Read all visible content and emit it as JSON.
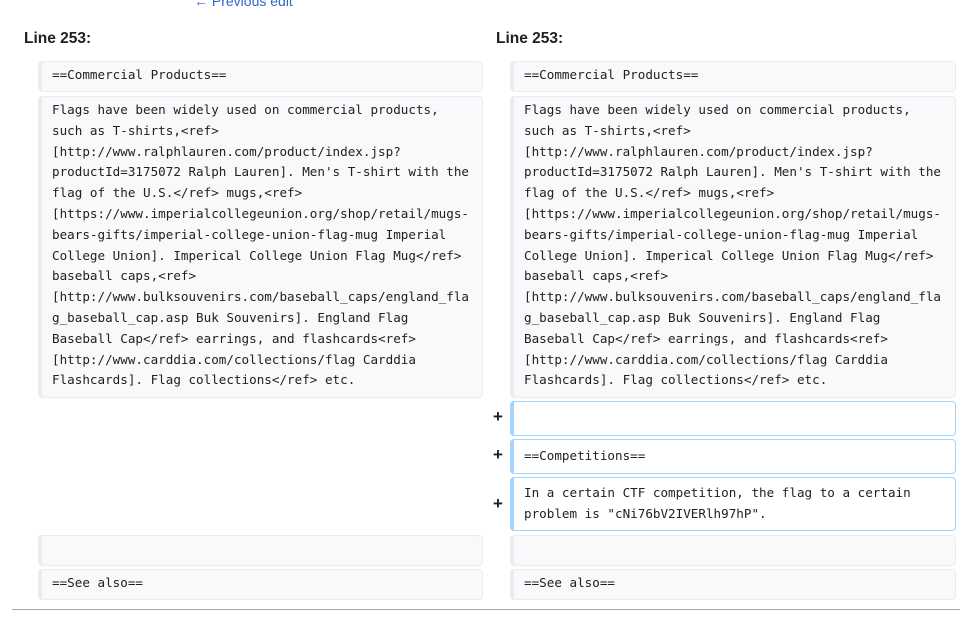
{
  "nav": {
    "previous_edit": "← Previous edit"
  },
  "left": {
    "header": "Line 253:",
    "rows": [
      "==Commercial Products==",
      "Flags have been widely used on commercial products, such as T-shirts,<ref>[http://www.ralphlauren.com/product/index.jsp?productId=3175072 Ralph Lauren]. Men's T-shirt with the flag of the U.S.</ref> mugs,<ref>[https://www.imperialcollegeunion.org/shop/retail/mugs-bears-gifts/imperial-college-union-flag-mug Imperial College Union]. Imperical College Union Flag Mug</ref> baseball caps,<ref>[http://www.bulksouvenirs.com/baseball_caps/england_flag_baseball_cap.asp Buk Souvenirs]. England Flag Baseball Cap</ref> earrings, and flashcards<ref>[http://www.carddia.com/collections/flag Carddia Flashcards]. Flag collections</ref> etc.",
      "",
      "==See also=="
    ]
  },
  "right": {
    "header": "Line 253:",
    "rows": [
      "==Commercial Products==",
      "Flags have been widely used on commercial products, such as T-shirts,<ref>[http://www.ralphlauren.com/product/index.jsp?productId=3175072 Ralph Lauren]. Men's T-shirt with the flag of the U.S.</ref> mugs,<ref>[https://www.imperialcollegeunion.org/shop/retail/mugs-bears-gifts/imperial-college-union-flag-mug Imperial College Union]. Imperical College Union Flag Mug</ref> baseball caps,<ref>[http://www.bulksouvenirs.com/baseball_caps/england_flag_baseball_cap.asp Buk Souvenirs]. England Flag Baseball Cap</ref> earrings, and flashcards<ref>[http://www.carddia.com/collections/flag Carddia Flashcards]. Flag collections</ref> etc.",
      "",
      "==See also=="
    ]
  },
  "added": {
    "marker": "+",
    "lines": [
      "",
      "==Competitions==",
      "In a certain CTF competition, the flag to a certain problem is \"cNi76bV2IVERlh97hP\"."
    ]
  },
  "colors": {
    "link": "#3366cc",
    "context_bg": "#f8f9fa",
    "context_border": "#eaecf0",
    "added_border": "#a3d3ff"
  }
}
